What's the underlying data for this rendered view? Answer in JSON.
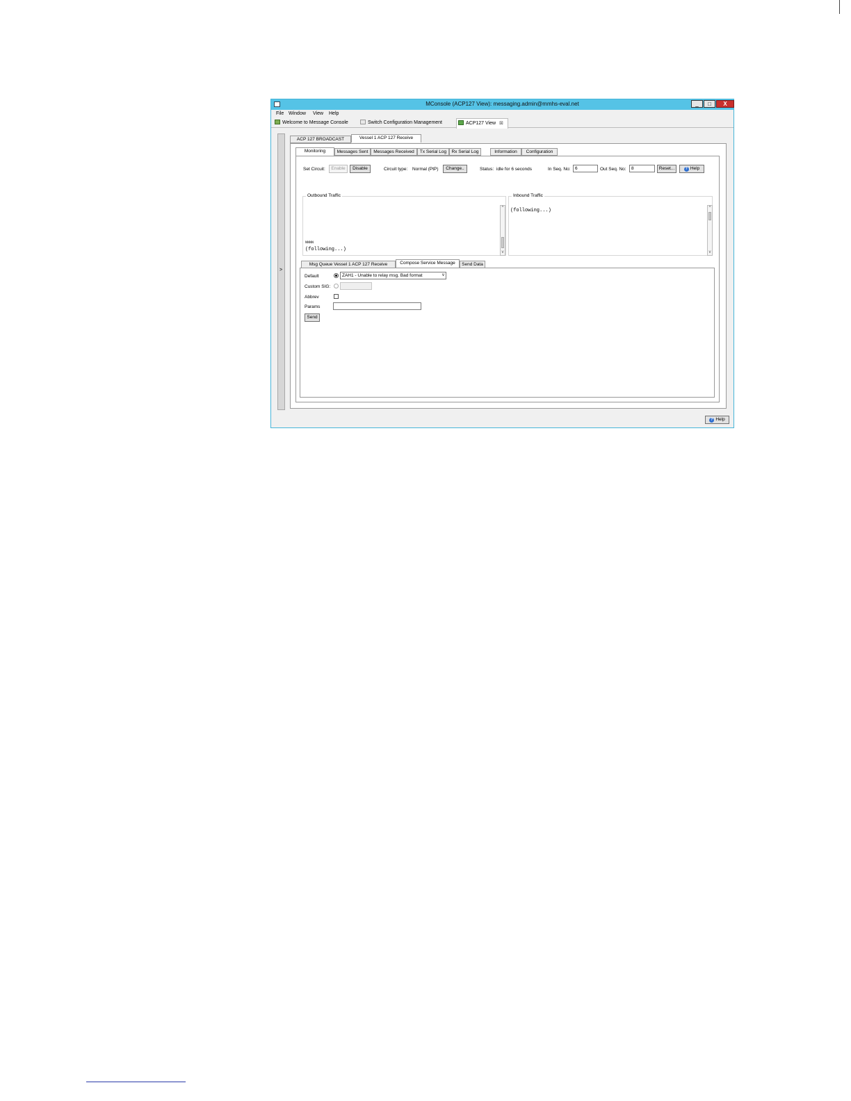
{
  "window": {
    "title": "MConsole (ACP127 View): messaging.admin@mmhs-eval.net",
    "minimize": "_",
    "maximize": "□",
    "close": "X"
  },
  "menu": [
    "File",
    "Window",
    "View",
    "Help"
  ],
  "perspective_tabs": [
    "Welcome to Message Console",
    "Switch Configuration Management",
    "ACP127 View",
    "⊠"
  ],
  "left_strip": {
    "label": ">"
  },
  "circuit_tabs": [
    "ACP 127 BROADCAST",
    "Vessel 1 ACP 127 Receive"
  ],
  "view_tabs": [
    "Monitoring",
    "Messages Sent",
    "Messages Received",
    "Tx Serial Log",
    "Rx Serial Log",
    "Information",
    "Configuration"
  ],
  "controls": {
    "set_circuit_label": "Set Circuit:",
    "enable": "Enable",
    "disable": "Disable",
    "circuit_type_label": "Circuit type:",
    "circuit_type_value": "Normal (PtP)",
    "change": "Change..",
    "status_label": "Status:",
    "status_value": "idle for 6 seconds",
    "in_seq_label": "In Seq. No:",
    "in_seq_value": "6",
    "out_seq_label": "Out Seq. No:",
    "out_seq_value": "8",
    "reset": "Reset...",
    "help": "Help"
  },
  "outbound": {
    "title": "Outbound Traffic",
    "line1": "NNNN",
    "line2": "(following...)"
  },
  "inbound": {
    "title": "Inbound Traffic",
    "line1": "(following...)"
  },
  "lower_tabs": [
    "Msg Queue Vessel 1 ACP 127 Receive",
    "Compose Service Message",
    "Send Data"
  ],
  "compose": {
    "default_label": "Default",
    "default_option": "ZAH1 - Unable to relay msg. Bad format",
    "custom_sig_label": "Custom SIG:",
    "custom_sig_value": "",
    "abbrev_label": "Abbrev",
    "params_label": "Params",
    "params_value": "",
    "send": "Send"
  },
  "footer": {
    "help": "Help"
  }
}
